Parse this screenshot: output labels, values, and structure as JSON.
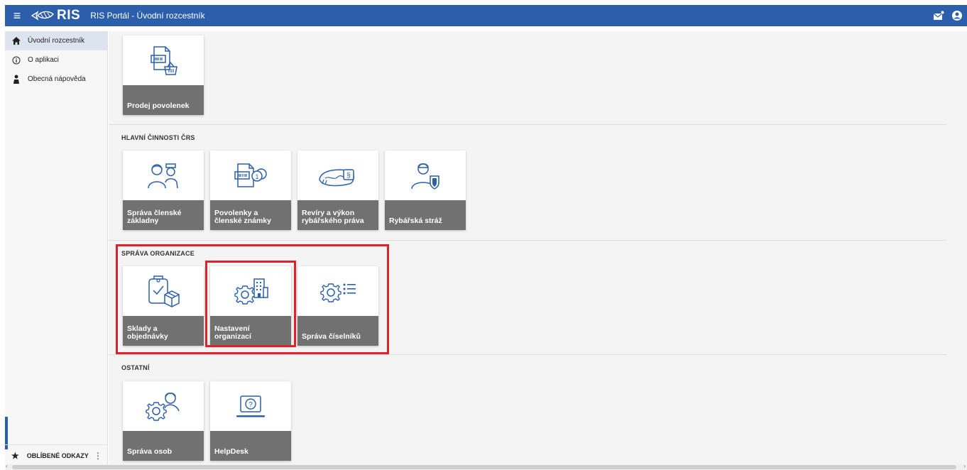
{
  "appbar": {
    "logo_text": "RIS",
    "title": "RIS Portál - Úvodní rozcestník"
  },
  "sidebar": {
    "items": [
      {
        "label": "Úvodní rozcestník",
        "icon": "home-icon"
      },
      {
        "label": "O aplikaci",
        "icon": "info-icon"
      },
      {
        "label": "Obecná nápověda",
        "icon": "help-person-icon"
      }
    ],
    "favorites_label": "OBLÍBENÉ ODKAZY"
  },
  "top_tiles": [
    {
      "label": "Prodej povolenek",
      "icon": "permit-sale-icon"
    }
  ],
  "sections": [
    {
      "title": "HLAVNÍ ČINNOSTI ČRS",
      "tiles": [
        {
          "label": "Správa členské základny",
          "icon": "members-icon"
        },
        {
          "label": "Povolenky a členské známky",
          "icon": "permits-stamps-icon"
        },
        {
          "label": "Revíry a výkon rybářského práva",
          "icon": "fishing-grounds-icon"
        },
        {
          "label": "Rybářská stráž",
          "icon": "fishing-guard-icon"
        }
      ]
    },
    {
      "title": "SPRÁVA ORGANIZACE",
      "tiles": [
        {
          "label": "Sklady a objednávky",
          "icon": "warehouse-orders-icon"
        },
        {
          "label": "Nastavení organizací",
          "icon": "organization-settings-icon"
        },
        {
          "label": "Správa číselníků",
          "icon": "codelists-icon"
        }
      ]
    },
    {
      "title": "OSTATNÍ",
      "tiles": [
        {
          "label": "Správa osob",
          "icon": "people-settings-icon"
        },
        {
          "label": "HelpDesk",
          "icon": "helpdesk-icon"
        }
      ]
    }
  ],
  "colors": {
    "appbar": "#2b5fab",
    "tile_label_bg": "#717171",
    "highlight": "#e0202a",
    "icon_stroke": "#2b5fab"
  }
}
